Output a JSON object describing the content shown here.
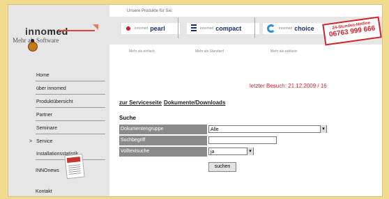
{
  "colors": {
    "frame_bg": "#f1dc8e",
    "sidebar": "#e6e6e6",
    "accent": "#d2232a",
    "label_bg": "#8a8a8a"
  },
  "header": {
    "top_text": "Unsere Produkte für Sie:",
    "logo_part1": "inno",
    "logo_part2": "med",
    "slogan": "Mehr als Software",
    "products": [
      {
        "prefix": "innomed",
        "name": "pearl",
        "icon": "pearl-icon",
        "sub": "Mehr als einfach"
      },
      {
        "prefix": "innomed",
        "name": "compact",
        "icon": "compact-icon",
        "sub": "Mehr als Standard"
      },
      {
        "prefix": "innomed",
        "name": "choice",
        "icon": "choice-icon",
        "sub": "Mehr als exklusiv"
      }
    ],
    "hotline_title": "24-Stunden-Hotline",
    "hotline_number": "06763 999 666"
  },
  "sidebar": {
    "items": [
      {
        "label": "Home"
      },
      {
        "label": "über innomed"
      },
      {
        "label": "Produktübersicht"
      },
      {
        "label": "Partner"
      },
      {
        "label": "Seminare"
      },
      {
        "label": "Service",
        "active": true
      },
      {
        "label": "Installationsstatistik"
      }
    ],
    "news_label": "INNOnews",
    "kontakt": "Kontakt"
  },
  "main": {
    "last_visit": "letzter Besuch: 21.12.2009 / 16",
    "links": [
      "zur Serviceseite",
      "Dokumente/Downloads"
    ],
    "search_title": "Suche",
    "fields": [
      {
        "label": "Dokumentengruppe",
        "value": "Alle"
      },
      {
        "label": "Suchbegriff",
        "value": ""
      },
      {
        "label": "Volltextsuche",
        "value": "ja"
      }
    ],
    "button": "suchen"
  }
}
